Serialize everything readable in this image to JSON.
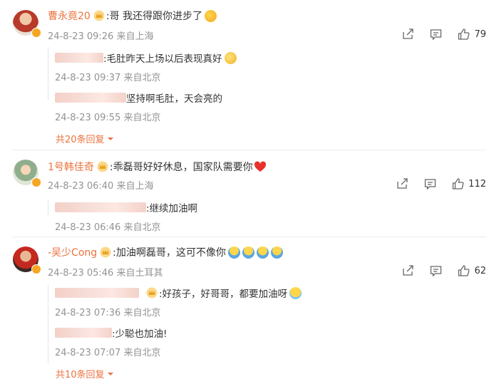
{
  "comments": [
    {
      "username": "曹永竟20",
      "text": ":哥 我还得跟你进步了",
      "meta": "24-8-23 09:26 来自上海",
      "likes": "79",
      "replies": [
        {
          "text": ":毛肚昨天上场以后表现真好",
          "meta": "24-8-23 09:37 来自北京"
        },
        {
          "text": "坚持啊毛肚，天会亮的",
          "meta": "24-8-23 09:55 来自北京"
        }
      ],
      "more": "共20条回复"
    },
    {
      "username": "1号韩佳奇",
      "text": ":乖磊哥好好休息，国家队需要你",
      "meta": "24-8-23 06:40 来自上海",
      "likes": "112",
      "replies": [
        {
          "text": ":继续加油啊",
          "meta": "24-8-23 06:46 来自北京"
        }
      ]
    },
    {
      "username": "-吴少Cong",
      "text": ":加油啊磊哥，这可不像你",
      "meta": "24-8-23 05:46 来自土耳其",
      "likes": "62",
      "replies": [
        {
          "text": ":好孩子，好哥哥，都要加油呀",
          "meta": "24-8-23 07:36 来自北京"
        },
        {
          "text": ":少聪也加油!",
          "meta": "24-8-23 07:07 来自北京"
        }
      ],
      "more": "共10条回复"
    }
  ],
  "colors": {
    "username": "#eb7340",
    "meta": "#939393",
    "badge": "#f5a623"
  },
  "icons": [
    "share-icon",
    "comment-icon",
    "like-icon",
    "crown-icon",
    "chevron-down-icon"
  ]
}
